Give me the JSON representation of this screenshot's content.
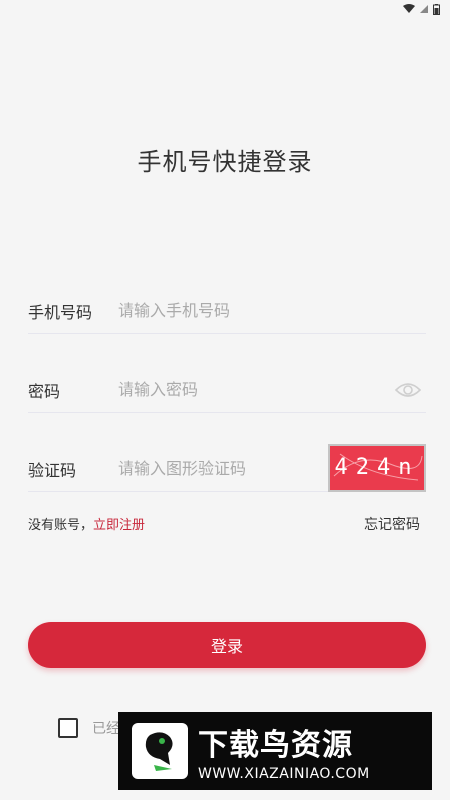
{
  "status_bar": {
    "icons": [
      "wifi-icon",
      "signal-icon",
      "battery-icon"
    ]
  },
  "page": {
    "title": "手机号快捷登录"
  },
  "form": {
    "phone": {
      "label": "手机号码",
      "placeholder": "请输入手机号码",
      "value": ""
    },
    "password": {
      "label": "密码",
      "placeholder": "请输入密码",
      "value": "",
      "toggle_icon": "eye-icon"
    },
    "captcha": {
      "label": "验证码",
      "placeholder": "请输入图形验证码",
      "value": "",
      "image_text": "424n",
      "image_color": "#ea3b4d"
    }
  },
  "links": {
    "no_account": "没有账号，",
    "register": "立即注册",
    "forgot": "忘记密码"
  },
  "login_button": {
    "label": "登录",
    "color": "#d6283b"
  },
  "agreement": {
    "text": "已经",
    "checked": false
  },
  "watermark": {
    "title": "下载鸟资源",
    "url": "WWW.XIAZAINIAO.COM"
  }
}
